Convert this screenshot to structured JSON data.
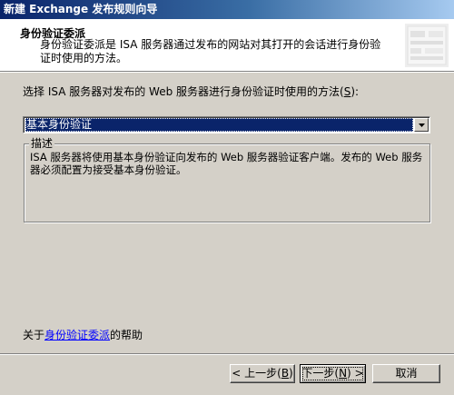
{
  "window": {
    "title": "新建 Exchange 发布规则向导"
  },
  "header": {
    "title": "身份验证委派",
    "description": "身份验证委派是 ISA 服务器通过发布的网站对其打开的会话进行身份验证时使用的方法。",
    "graphic_icon": "wizard-header-graphic"
  },
  "main": {
    "prompt_label_pre": "选择 ISA 服务器对发布的 Web 服务器进行身份验证时使用的方法(",
    "prompt_label_key": "S",
    "prompt_label_post": "):",
    "method_select": {
      "selected": "基本身份验证",
      "arrow_icon": "chevron-down-icon"
    },
    "description_group": {
      "legend": "描述",
      "text": "ISA 服务器将使用基本身份验证向发布的 Web 服务器验证客户端。发布的 Web 服务器必须配置为接受基本身份验证。"
    },
    "help": {
      "prefix": "关于",
      "link": "身份验证委派",
      "suffix": "的帮助"
    }
  },
  "buttons": {
    "back_pre": "< 上一步(",
    "back_key": "B",
    "back_post": ")",
    "next_pre": "下一步(",
    "next_key": "N",
    "next_post": ") >",
    "cancel": "取消"
  },
  "colors": {
    "titlebar_start": "#0a246a",
    "titlebar_end": "#a6caf0",
    "selection": "#0a246a",
    "link": "#0000ff",
    "dialog_bg": "#d4d0c8"
  }
}
